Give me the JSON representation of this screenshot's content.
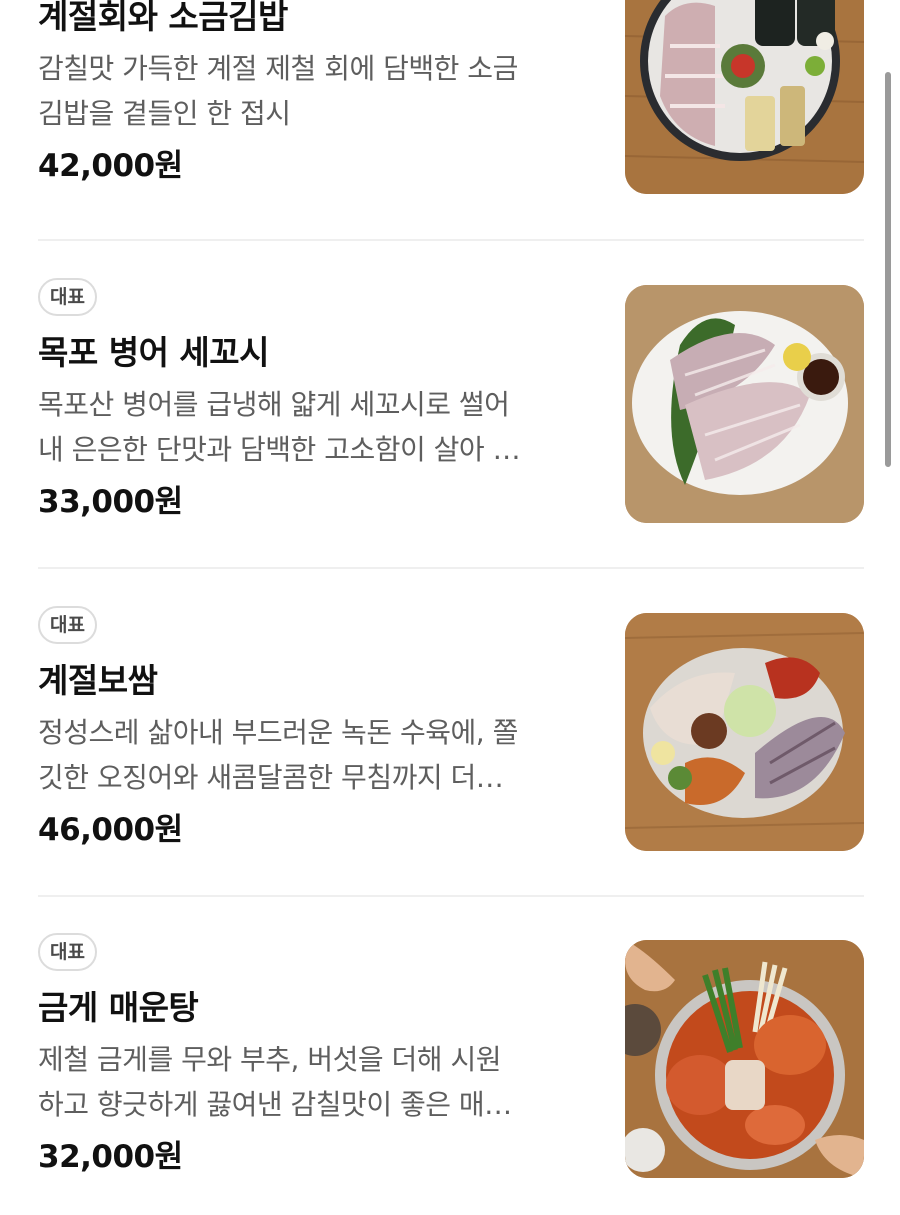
{
  "menu": {
    "items": [
      {
        "badge": "",
        "name": "계절회와 소금김밥",
        "desc_lines": [
          "감칠맛 가득한 계절 제철 회에 담백한 소금",
          "김밥을 곁들인 한 접시"
        ],
        "price": "42,000원",
        "photo_icon": "sashimi-gimbap-platter-photo"
      },
      {
        "badge": "대표",
        "name": "목포 병어 세꼬시",
        "desc_lines": [
          "목포산 병어를 급냉해 얇게 세꼬시로 썰어",
          "내 은은한 단맛과 담백한 고소함이 살아 …"
        ],
        "price": "33,000원",
        "photo_icon": "pomfret-sekkoshi-photo"
      },
      {
        "badge": "대표",
        "name": "계절보쌈",
        "desc_lines": [
          "정성스레 삶아내 부드러운 녹돈 수육에, 쫄",
          "깃한 오징어와 새콤달콤한 무침까지 더…"
        ],
        "price": "46,000원",
        "photo_icon": "seasonal-bossam-photo"
      },
      {
        "badge": "대표",
        "name": "금게 매운탕",
        "desc_lines": [
          "제철 금게를 무와 부추, 버섯을 더해 시원",
          "하고 향긋하게 끓여낸 감칠맛이 좋은 매…"
        ],
        "price": "32,000원",
        "photo_icon": "crab-spicy-stew-photo"
      }
    ]
  },
  "colors": {
    "text_primary": "#111111",
    "text_secondary": "#5e5e5e",
    "badge_border": "#dcdcdc",
    "divider": "#efefef",
    "wood_table": "#a7733f"
  }
}
